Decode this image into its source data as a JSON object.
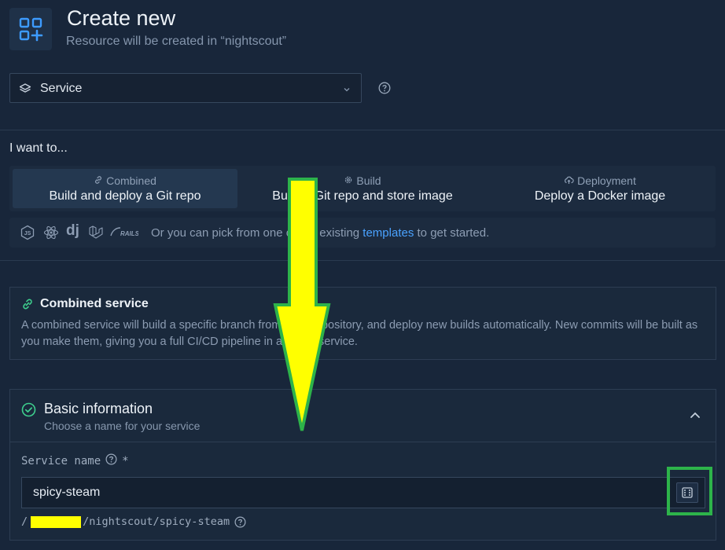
{
  "header": {
    "title": "Create new",
    "subtitle": "Resource will be created in “nightscout”"
  },
  "resource_select": {
    "value": "Service"
  },
  "intent": {
    "label": "I want to...",
    "tabs": [
      {
        "category": "Combined",
        "label": "Build and deploy a Git repo",
        "icon": "link-icon",
        "active": true
      },
      {
        "category": "Build",
        "label": "Build a Git repo and store image",
        "icon": "gear-icon",
        "active": false
      },
      {
        "category": "Deployment",
        "label": "Deploy a Docker image",
        "icon": "cloud-upload-icon",
        "active": false
      }
    ],
    "templates": {
      "icons": [
        "nodejs-icon",
        "react-icon",
        "django-icon",
        "laravel-icon",
        "rails-icon"
      ],
      "django_text": "dj",
      "rails_text": "RAILS",
      "prefix": "Or you can pick from one of our existing ",
      "link": "templates",
      "suffix": " to get started."
    }
  },
  "info": {
    "title": "Combined service",
    "text": "A combined service will build a specific branch from a Git repository, and deploy new builds automatically. New commits will be built as you make them, giving you a full CI/CD pipeline in a single service."
  },
  "basic_info": {
    "title": "Basic information",
    "subtitle": "Choose a name for your service",
    "field_label": "Service name",
    "required_mark": "*",
    "value": "spicy-steam",
    "path_prefix": "/",
    "path_suffix": "/nightscout/spicy-steam"
  },
  "colors": {
    "accent": "#4aa2ff",
    "success": "#3ecf8e",
    "annotation_arrow": "#ffff00",
    "annotation_border": "#2db34a"
  }
}
